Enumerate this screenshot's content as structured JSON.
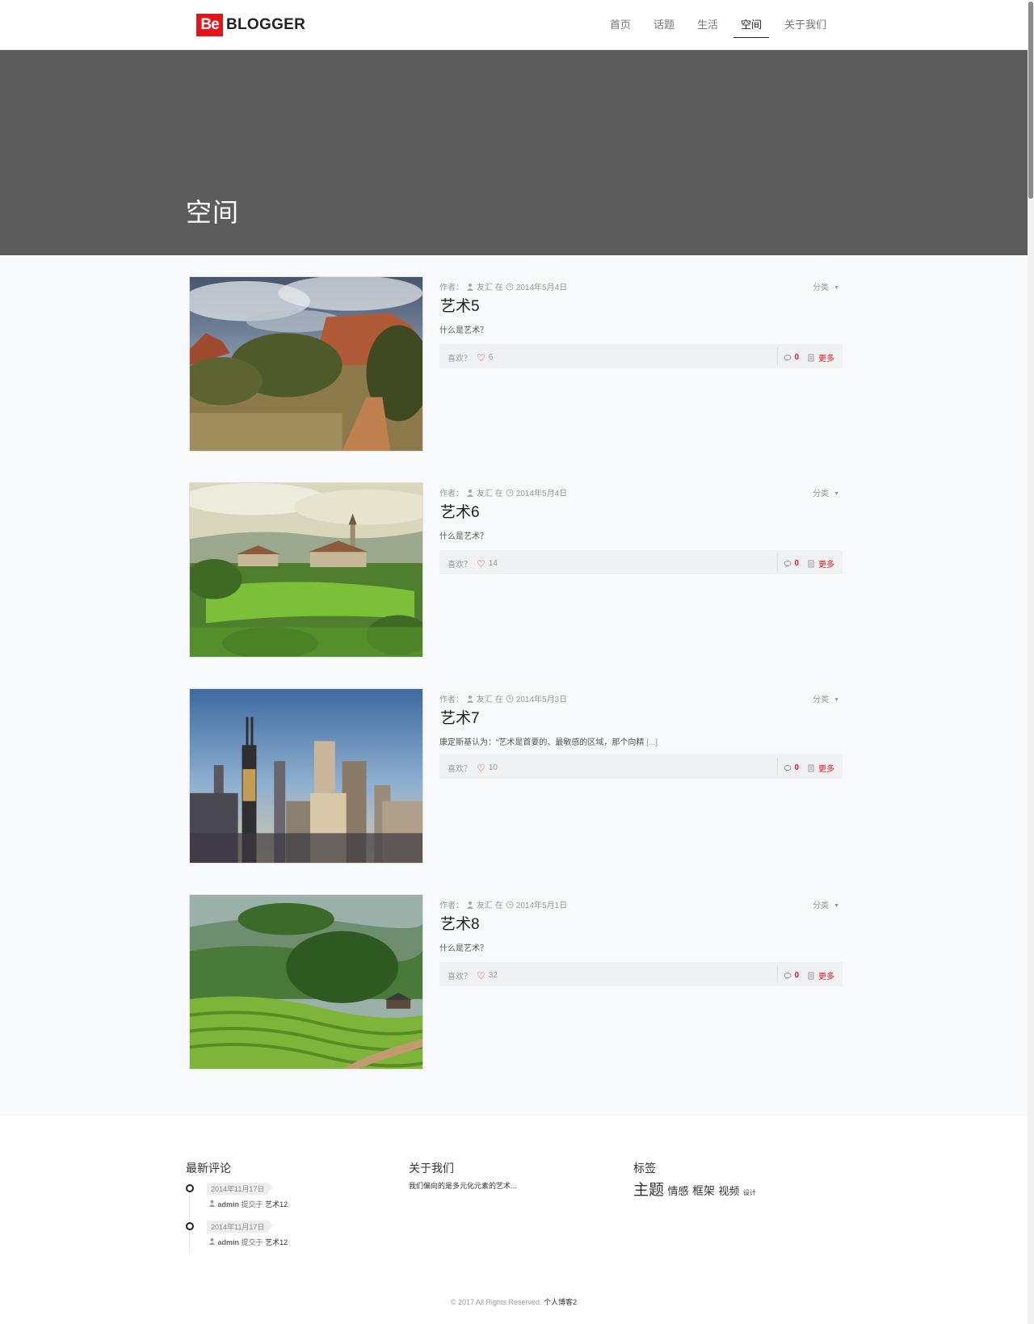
{
  "brand": {
    "logo_mark": "Be",
    "name": "BLOGGER",
    "accent": "#e3141a"
  },
  "nav": [
    {
      "label": "首页",
      "active": false
    },
    {
      "label": "话题",
      "active": false
    },
    {
      "label": "生活",
      "active": false
    },
    {
      "label": "空间",
      "active": true
    },
    {
      "label": "关于我们",
      "active": false
    }
  ],
  "banner": {
    "title": "空间",
    "bg": "#5c5c5c"
  },
  "labels": {
    "author_prefix": "作者：",
    "at": "在",
    "category": "分类",
    "like": "喜欢？",
    "more": "更多"
  },
  "posts": [
    {
      "author": "友汇",
      "date": "2014年5月4日",
      "title": "艺术5",
      "excerpt": "什么是艺术？",
      "excerpt_more": "",
      "likes": "6",
      "comments": "0",
      "image": "canyon-landscape"
    },
    {
      "author": "友汇",
      "date": "2014年5月4日",
      "title": "艺术6",
      "excerpt": "什么是艺术？",
      "excerpt_more": "",
      "likes": "14",
      "comments": "0",
      "image": "village-landscape"
    },
    {
      "author": "友汇",
      "date": "2014年5月3日",
      "title": "艺术7",
      "excerpt": "康定斯基认为：“艺术是首要的、最敏感的区域，那个向精 ",
      "excerpt_more": "[...]",
      "likes": "10",
      "comments": "0",
      "image": "city-skyline"
    },
    {
      "author": "友汇",
      "date": "2014年5月1日",
      "title": "艺术8",
      "excerpt": "什么是艺术？",
      "excerpt_more": "",
      "likes": "32",
      "comments": "0",
      "image": "rice-terraces"
    }
  ],
  "widgets": {
    "recent_comments": {
      "title": "最新评论",
      "items": [
        {
          "date": "2014年11月17日",
          "user": "admin",
          "verb": "提交于",
          "target": "艺术12"
        },
        {
          "date": "2014年11月17日",
          "user": "admin",
          "verb": "提交于",
          "target": "艺术12"
        }
      ]
    },
    "about": {
      "title": "关于我们",
      "text": "我们偏向的是多元化元素的艺术..."
    },
    "tags": {
      "title": "标签",
      "items": [
        "主题",
        "情感",
        "框架",
        "视频",
        "设计"
      ]
    }
  },
  "footer": {
    "copyright": "© 2017 All Rights Reserved.",
    "site": "个人博客2"
  }
}
